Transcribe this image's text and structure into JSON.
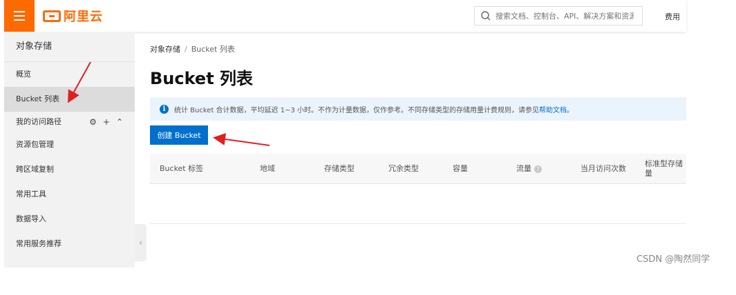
{
  "header": {
    "logo_text": "阿里云",
    "search_placeholder": "搜索文档、控制台、API、解决方案和资源",
    "fee_label": "费用"
  },
  "sidebar": {
    "title": "对象存储",
    "items": [
      {
        "label": "概览"
      },
      {
        "label": "Bucket 列表",
        "active": true
      }
    ],
    "group_label": "我的访问路径",
    "group_items": [
      {
        "label": "资源包管理"
      },
      {
        "label": "跨区域复制"
      },
      {
        "label": "常用工具"
      },
      {
        "label": "数据导入"
      },
      {
        "label": "常用服务推荐"
      }
    ]
  },
  "main": {
    "breadcrumb": [
      "对象存储",
      "Bucket 列表"
    ],
    "title": "Bucket 列表",
    "info_text": "统计 Bucket 合计数据，平均延迟 1~3 小时。不作为计量数据，仅作参考。不同存储类型的存储用量计费规则，请参见",
    "info_link": "帮助文档",
    "info_end": "。",
    "create_button": "创建 Bucket",
    "columns": [
      "Bucket 标签",
      "地域",
      "存储类型",
      "冗余类型",
      "容量",
      "流量",
      "当月访问次数",
      "标准型存储量"
    ]
  },
  "colors": {
    "brand": "#ff6a00",
    "primary": "#0070cc",
    "annotation_arrow": "#e02020"
  },
  "watermark": "CSDN @陶然同学"
}
